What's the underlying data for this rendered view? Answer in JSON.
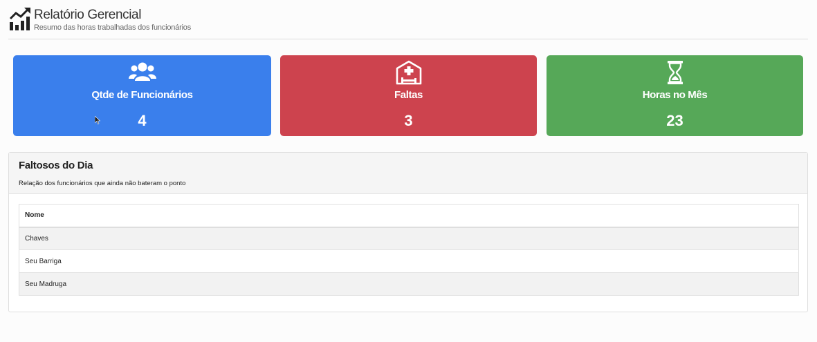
{
  "header": {
    "title": "Relatório Gerencial",
    "subtitle": "Resumo das horas trabalhadas dos funcionários",
    "icon": "chart-line-icon"
  },
  "cards": [
    {
      "label": "Qtde de Funcionários",
      "value": "4",
      "icon": "users-icon",
      "color": "#3a7fec"
    },
    {
      "label": "Faltas",
      "value": "3",
      "icon": "hospital-bed-icon",
      "color": "#cd434e"
    },
    {
      "label": "Horas no Mês",
      "value": "23",
      "icon": "hourglass-icon",
      "color": "#56a858"
    }
  ],
  "absent_panel": {
    "title": "Faltosos do Dia",
    "subtitle": "Relação dos funcionários que ainda não bateram o ponto",
    "columns": [
      "Nome"
    ],
    "rows": [
      "Chaves",
      "Seu Barriga",
      "Seu Madruga"
    ]
  }
}
